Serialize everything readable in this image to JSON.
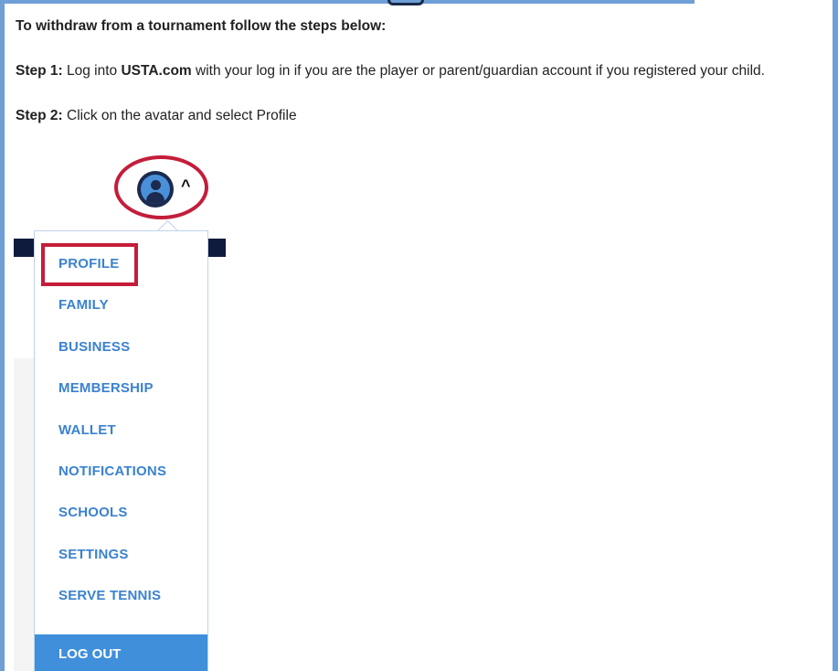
{
  "instructions": {
    "heading": "To withdraw from a tournament follow the steps below:",
    "step1_label": "Step 1:",
    "step1_pre": " Log into ",
    "step1_site": "USTA.com",
    "step1_post": " with your log in if you are the player or parent/guardian account if you registered your child.",
    "step2_label": "Step 2:",
    "step2_text": " Click on the avatar and select Profile"
  },
  "avatar": {
    "icon": "user-avatar-icon",
    "chevron": "^"
  },
  "menu": {
    "items": [
      {
        "label": "PROFILE",
        "highlighted": true
      },
      {
        "label": "FAMILY"
      },
      {
        "label": "BUSINESS"
      },
      {
        "label": "MEMBERSHIP"
      },
      {
        "label": "WALLET"
      },
      {
        "label": "NOTIFICATIONS"
      },
      {
        "label": "SCHOOLS"
      },
      {
        "label": "SETTINGS"
      },
      {
        "label": "SERVE TENNIS"
      }
    ],
    "logout_label": "LOG OUT"
  },
  "colors": {
    "menu_text": "#3b82cf",
    "highlight": "#c41d3a",
    "logout_bg": "#3f8fdb",
    "navbar": "#0f1b3d",
    "frame": "#6e9fd6"
  }
}
